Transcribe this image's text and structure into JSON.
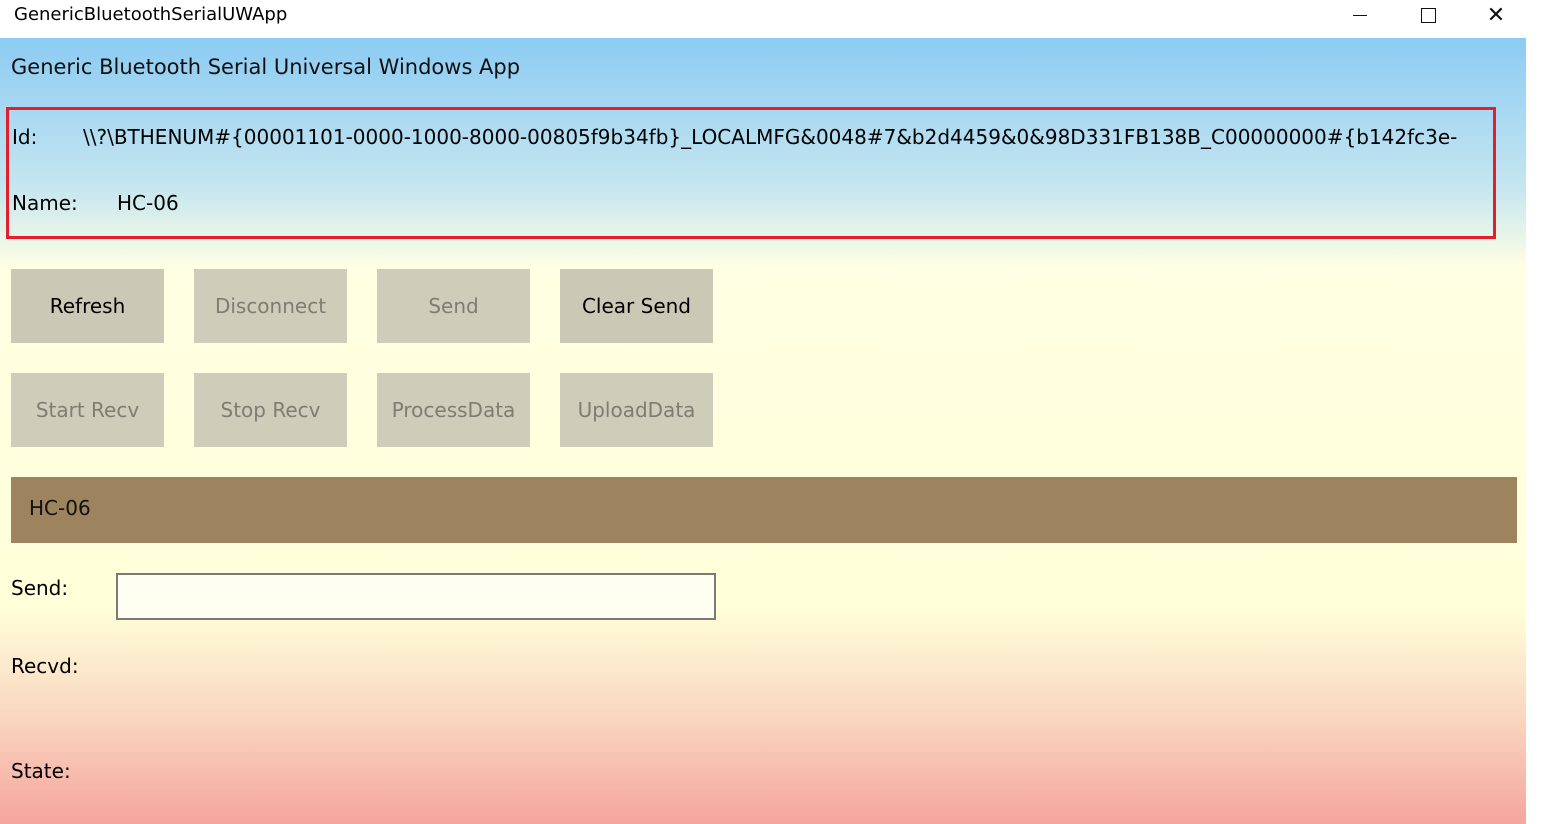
{
  "window": {
    "title": "GenericBluetoothSerialUWApp",
    "close_glyph": "✕"
  },
  "app": {
    "title": "Generic Bluetooth Serial Universal Windows App"
  },
  "device": {
    "id_label": "Id:",
    "id_value": "\\\\?\\BTHENUM#{00001101-0000-1000-8000-00805f9b34fb}_LOCALMFG&0048#7&b2d4459&0&98D331FB138B_C00000000#{b142fc3e-",
    "name_label": "Name:",
    "name_value": "HC-06"
  },
  "buttons": {
    "row1": [
      {
        "label": "Refresh",
        "enabled": true
      },
      {
        "label": "Disconnect",
        "enabled": false
      },
      {
        "label": "Send",
        "enabled": false
      },
      {
        "label": "Clear Send",
        "enabled": true
      }
    ],
    "row2": [
      {
        "label": "Start Recv",
        "enabled": false
      },
      {
        "label": "Stop Recv",
        "enabled": false
      },
      {
        "label": "ProcessData",
        "enabled": false
      },
      {
        "label": "UploadData",
        "enabled": false
      }
    ]
  },
  "device_header": {
    "name": "HC-06"
  },
  "fields": {
    "send_label": "Send:",
    "send_value": "",
    "recvd_label": "Recvd:",
    "state_label": "State:"
  },
  "colors": {
    "highlight_border": "#e21f2b",
    "header_bar": "#9e845e",
    "button_bg": "#c9c9b5"
  }
}
